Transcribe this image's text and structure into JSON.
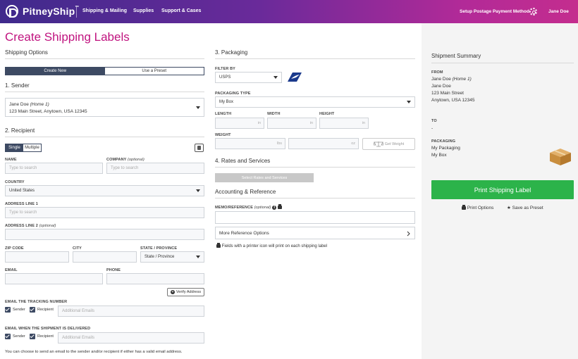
{
  "header": {
    "brand": "PitneyShip",
    "tm": "™",
    "nav": [
      "Shipping & Mailing",
      "Supplies",
      "Support & Cases"
    ],
    "postage": "Setup Postage Payment Method",
    "user": "Jane Doe"
  },
  "page": {
    "title": "Create Shipping Labels"
  },
  "shipping_options": {
    "title": "Shipping Options",
    "create_new": "Create New",
    "use_preset": "Use a Preset"
  },
  "sender": {
    "title": "1. Sender",
    "name": "Jane Doe",
    "nickname": "(Home 1)",
    "address": "123 Main Street, Anytown, USA 12345"
  },
  "recipient": {
    "title": "2. Recipient",
    "single": "Single",
    "multiple": "Multiple",
    "name_label": "NAME",
    "name_ph": "Type to search",
    "company_label": "COMPANY",
    "company_opt": "(optional)",
    "company_ph": "Type to search",
    "country_label": "COUNTRY",
    "country_value": "United States",
    "addr1_label": "ADDRESS LINE 1",
    "addr1_ph": "Type to search",
    "addr2_label": "ADDRESS LINE 2",
    "addr2_opt": "(optional)",
    "zip_label": "ZIP CODE",
    "city_label": "CITY",
    "state_label": "STATE / PROVINCE",
    "state_value": "State / Province",
    "email_label": "EMAIL",
    "phone_label": "PHONE",
    "verify": "Verify Address",
    "track_label": "EMAIL THE TRACKING NUMBER",
    "sender_chk": "Sender",
    "recipient_chk": "Recipient",
    "add_emails_ph": "Additional Emails",
    "delivered_label": "EMAIL WHEN THE SHIPMENT IS DELIVERED",
    "sender_chk2": "Sender",
    "recipient_chk2": "Recipient",
    "add_emails_ph2": "Additional Emails",
    "footnote": "You can choose to send an email to the sender and/or recipient if either has a valid email address."
  },
  "packaging": {
    "title": "3. Packaging",
    "filter_label": "FILTER BY",
    "filter_value": "USPS",
    "type_label": "PACKAGING TYPE",
    "type_value": "My Box",
    "length_label": "LENGTH",
    "width_label": "WIDTH",
    "height_label": "HEIGHT",
    "unit_in": "in",
    "weight_label": "WEIGHT",
    "unit_lbs": "lbs",
    "unit_oz": "oz",
    "get_weight": "Get Weight"
  },
  "rates": {
    "title": "4. Rates and Services",
    "select": "Select Rates and Services"
  },
  "accounting": {
    "title": "Accounting & Reference",
    "memo_label": "MEMO/REFERENCE",
    "memo_opt": "(optional)",
    "more": "More Reference Options",
    "note": "Fields with a printer icon will print on each shipping label"
  },
  "summary": {
    "title": "Shipment Summary",
    "from_label": "FROM",
    "from_name": "Jane Doe",
    "from_nick": "(Home 1)",
    "from_line2": "Jane Doe",
    "from_street": "123 Main Street",
    "from_city": "Anytown, USA 12345",
    "to_label": "TO",
    "to_value": "-",
    "pack_label": "PACKAGING",
    "pack_line1": "My Packaging",
    "pack_line2": "My Box",
    "print_label": "Print Shipping Label",
    "print_options": "Print Options",
    "save_preset": "Save as Preset"
  },
  "colors": {
    "accent": "#c0137f",
    "header_start": "#3f2a8c",
    "header_end": "#c42d8e",
    "toggle": "#3d4a63",
    "green": "#2cb34a"
  }
}
